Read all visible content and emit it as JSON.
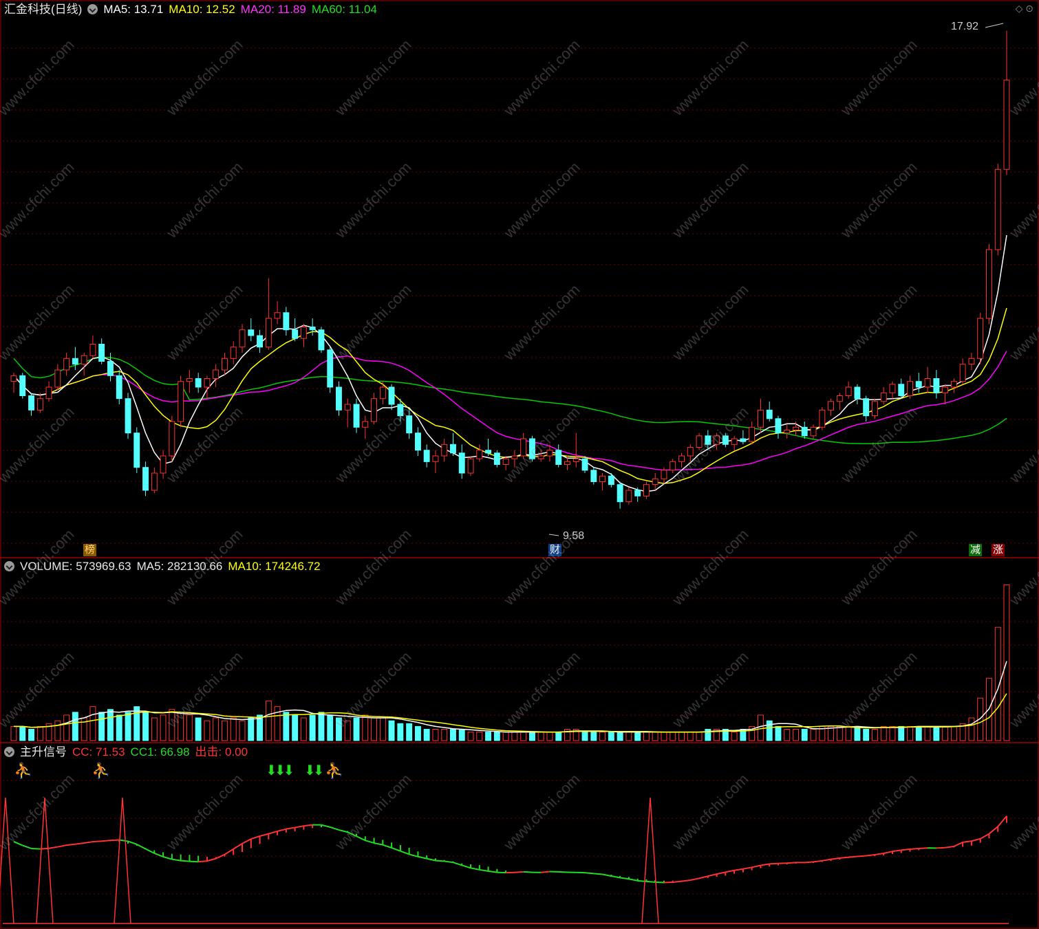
{
  "main_header": {
    "title": "汇金科技(日线)",
    "ma5": "MA5: 13.71",
    "ma10": "MA10: 12.52",
    "ma20": "MA20: 11.89",
    "ma60": "MA60: 11.04"
  },
  "price_labels": {
    "high": "17.92",
    "low": "9.58"
  },
  "event_tags": {
    "bang": "榜",
    "cai": "财",
    "jian": "减",
    "zhang": "涨"
  },
  "volume_header": {
    "title": "VOLUME: 573969.63",
    "ma5": "MA5: 282130.66",
    "ma10": "MA10: 174246.72"
  },
  "signal_header": {
    "title": "主升信号",
    "cc": "CC: 71.53",
    "cc1": "CC1: 66.98",
    "chuji": "出击: 0.00"
  },
  "watermark": "www.cfchi.com",
  "colors": {
    "up": "#ff3333",
    "down": "#54ffff",
    "ma5": "#ffffff",
    "ma10": "#ffff00",
    "ma20": "#ff00ff",
    "ma60": "#00cc00",
    "grid": "#6b0000",
    "frame": "#a00000"
  },
  "chart_data": {
    "type": "candlestick",
    "series": [
      {
        "name": "K",
        "ohlc": [
          [
            11.8,
            11.95,
            11.6,
            11.9
          ],
          [
            11.9,
            11.95,
            11.5,
            11.55
          ],
          [
            11.55,
            11.6,
            11.2,
            11.3
          ],
          [
            11.3,
            11.6,
            11.25,
            11.5
          ],
          [
            11.5,
            11.8,
            11.45,
            11.7
          ],
          [
            11.7,
            12.1,
            11.65,
            12.0
          ],
          [
            12.0,
            12.3,
            11.9,
            12.2
          ],
          [
            12.2,
            12.4,
            12.0,
            12.1
          ],
          [
            12.1,
            12.3,
            11.9,
            12.25
          ],
          [
            12.25,
            12.6,
            12.2,
            12.45
          ],
          [
            12.45,
            12.55,
            12.1,
            12.15
          ],
          [
            12.15,
            12.3,
            11.8,
            11.9
          ],
          [
            11.9,
            12.0,
            11.4,
            11.5
          ],
          [
            11.5,
            11.6,
            10.8,
            10.9
          ],
          [
            10.9,
            11.0,
            10.2,
            10.3
          ],
          [
            10.3,
            10.4,
            9.8,
            9.9
          ],
          [
            9.9,
            10.3,
            9.85,
            10.2
          ],
          [
            10.2,
            10.6,
            10.1,
            10.5
          ],
          [
            10.5,
            11.2,
            10.4,
            11.1
          ],
          [
            11.1,
            11.9,
            11.0,
            11.8
          ],
          [
            11.8,
            12.0,
            11.6,
            11.85
          ],
          [
            11.85,
            11.95,
            11.6,
            11.7
          ],
          [
            11.7,
            11.9,
            11.5,
            11.85
          ],
          [
            11.85,
            12.1,
            11.7,
            12.0
          ],
          [
            12.0,
            12.3,
            11.9,
            12.2
          ],
          [
            12.2,
            12.5,
            12.1,
            12.4
          ],
          [
            12.4,
            12.8,
            12.3,
            12.7
          ],
          [
            12.7,
            12.9,
            12.5,
            12.6
          ],
          [
            12.6,
            12.7,
            12.3,
            12.4
          ],
          [
            12.4,
            13.6,
            12.35,
            12.9
          ],
          [
            12.9,
            13.2,
            12.8,
            13.0
          ],
          [
            13.0,
            13.1,
            12.6,
            12.7
          ],
          [
            12.7,
            12.9,
            12.5,
            12.55
          ],
          [
            12.55,
            12.8,
            12.4,
            12.75
          ],
          [
            12.75,
            12.9,
            12.6,
            12.7
          ],
          [
            12.7,
            12.75,
            12.3,
            12.35
          ],
          [
            12.35,
            12.4,
            11.6,
            11.7
          ],
          [
            11.7,
            11.8,
            11.2,
            11.3
          ],
          [
            11.3,
            11.5,
            11.0,
            11.4
          ],
          [
            11.4,
            11.5,
            10.9,
            11.0
          ],
          [
            11.0,
            11.2,
            10.8,
            11.1
          ],
          [
            11.1,
            11.6,
            11.05,
            11.5
          ],
          [
            11.5,
            11.8,
            11.4,
            11.7
          ],
          [
            11.7,
            11.75,
            11.3,
            11.4
          ],
          [
            11.4,
            11.5,
            11.1,
            11.2
          ],
          [
            11.2,
            11.3,
            10.8,
            10.9
          ],
          [
            10.9,
            11.0,
            10.5,
            10.6
          ],
          [
            10.6,
            10.7,
            10.3,
            10.4
          ],
          [
            10.4,
            10.6,
            10.2,
            10.5
          ],
          [
            10.5,
            10.8,
            10.4,
            10.7
          ],
          [
            10.7,
            10.9,
            10.5,
            10.55
          ],
          [
            10.55,
            10.7,
            10.1,
            10.2
          ],
          [
            10.2,
            10.5,
            10.15,
            10.45
          ],
          [
            10.45,
            10.7,
            10.4,
            10.6
          ],
          [
            10.6,
            10.8,
            10.5,
            10.55
          ],
          [
            10.55,
            10.6,
            10.3,
            10.35
          ],
          [
            10.35,
            10.5,
            10.25,
            10.45
          ],
          [
            10.45,
            10.6,
            10.3,
            10.5
          ],
          [
            10.5,
            10.9,
            10.45,
            10.8
          ],
          [
            10.8,
            10.85,
            10.4,
            10.45
          ],
          [
            10.45,
            10.6,
            10.4,
            10.5
          ],
          [
            10.5,
            10.7,
            10.4,
            10.6
          ],
          [
            10.6,
            10.7,
            10.3,
            10.35
          ],
          [
            10.35,
            10.5,
            10.25,
            10.4
          ],
          [
            10.4,
            10.9,
            10.3,
            10.45
          ],
          [
            10.45,
            10.5,
            10.2,
            10.25
          ],
          [
            10.25,
            10.3,
            10.0,
            10.05
          ],
          [
            10.05,
            10.2,
            9.9,
            10.15
          ],
          [
            10.15,
            10.2,
            9.95,
            10.0
          ],
          [
            10.0,
            10.05,
            9.58,
            9.7
          ],
          [
            9.7,
            9.95,
            9.65,
            9.9
          ],
          [
            9.9,
            9.95,
            9.7,
            9.8
          ],
          [
            9.8,
            10.05,
            9.75,
            10.0
          ],
          [
            10.0,
            10.2,
            9.9,
            10.1
          ],
          [
            10.1,
            10.3,
            10.0,
            10.25
          ],
          [
            10.25,
            10.45,
            10.2,
            10.4
          ],
          [
            10.4,
            10.55,
            10.3,
            10.5
          ],
          [
            10.5,
            10.7,
            10.4,
            10.65
          ],
          [
            10.65,
            10.9,
            10.6,
            10.85
          ],
          [
            10.85,
            10.95,
            10.6,
            10.7
          ],
          [
            10.7,
            10.9,
            10.6,
            10.85
          ],
          [
            10.85,
            10.9,
            10.65,
            10.7
          ],
          [
            10.7,
            10.85,
            10.6,
            10.8
          ],
          [
            10.8,
            10.95,
            10.7,
            10.75
          ],
          [
            10.75,
            11.1,
            10.7,
            11.0
          ],
          [
            11.0,
            11.5,
            10.9,
            11.3
          ],
          [
            11.3,
            11.45,
            11.1,
            11.15
          ],
          [
            11.15,
            11.2,
            10.8,
            10.9
          ],
          [
            10.9,
            11.05,
            10.8,
            10.95
          ],
          [
            10.95,
            11.1,
            10.85,
            11.0
          ],
          [
            11.0,
            11.1,
            10.8,
            10.85
          ],
          [
            10.85,
            11.05,
            10.8,
            11.0
          ],
          [
            11.0,
            11.35,
            10.95,
            11.3
          ],
          [
            11.3,
            11.5,
            11.2,
            11.45
          ],
          [
            11.45,
            11.6,
            11.3,
            11.55
          ],
          [
            11.55,
            11.8,
            11.5,
            11.7
          ],
          [
            11.7,
            11.75,
            11.4,
            11.5
          ],
          [
            11.5,
            11.55,
            11.1,
            11.2
          ],
          [
            11.2,
            11.5,
            11.15,
            11.45
          ],
          [
            11.45,
            11.7,
            11.4,
            11.6
          ],
          [
            11.6,
            11.8,
            11.5,
            11.75
          ],
          [
            11.75,
            11.85,
            11.5,
            11.55
          ],
          [
            11.55,
            11.9,
            11.5,
            11.8
          ],
          [
            11.8,
            11.95,
            11.6,
            11.7
          ],
          [
            11.7,
            12.05,
            11.6,
            11.85
          ],
          [
            11.85,
            12.0,
            11.5,
            11.6
          ],
          [
            11.6,
            11.75,
            11.4,
            11.7
          ],
          [
            11.7,
            11.85,
            11.6,
            11.8
          ],
          [
            11.8,
            12.2,
            11.75,
            12.1
          ],
          [
            12.1,
            12.3,
            12.0,
            12.2
          ],
          [
            12.2,
            13.0,
            12.1,
            12.9
          ],
          [
            12.9,
            14.2,
            12.8,
            14.1
          ],
          [
            14.1,
            15.6,
            14.0,
            15.5
          ],
          [
            15.5,
            17.92,
            15.4,
            17.06
          ]
        ]
      },
      {
        "name": "VOLUME",
        "values": [
          5,
          5,
          4,
          5,
          6,
          7,
          9,
          10,
          8,
          12,
          10,
          11,
          9,
          10,
          12,
          10,
          8,
          9,
          11,
          10,
          9,
          8,
          7,
          8,
          7,
          8,
          7,
          8,
          9,
          14,
          12,
          10,
          9,
          8,
          9,
          10,
          9,
          8,
          7,
          8,
          9,
          8,
          8,
          7,
          6,
          6,
          5,
          4,
          4,
          4,
          4,
          4,
          3,
          3,
          3,
          3,
          3,
          3,
          3,
          3,
          3,
          3,
          3,
          4,
          4,
          3,
          3,
          3,
          3,
          3,
          3,
          3,
          3,
          3,
          3,
          3,
          3,
          3,
          3,
          4,
          4,
          4,
          3,
          4,
          5,
          9,
          7,
          5,
          4,
          4,
          4,
          4,
          5,
          5,
          5,
          5,
          5,
          4,
          4,
          5,
          5,
          5,
          5,
          5,
          5,
          5,
          5,
          5,
          6,
          8,
          15,
          22,
          40,
          55
        ]
      }
    ],
    "annotations": [
      "17.92",
      "9.58",
      "榜",
      "财",
      "减",
      "涨"
    ],
    "grid": true
  }
}
